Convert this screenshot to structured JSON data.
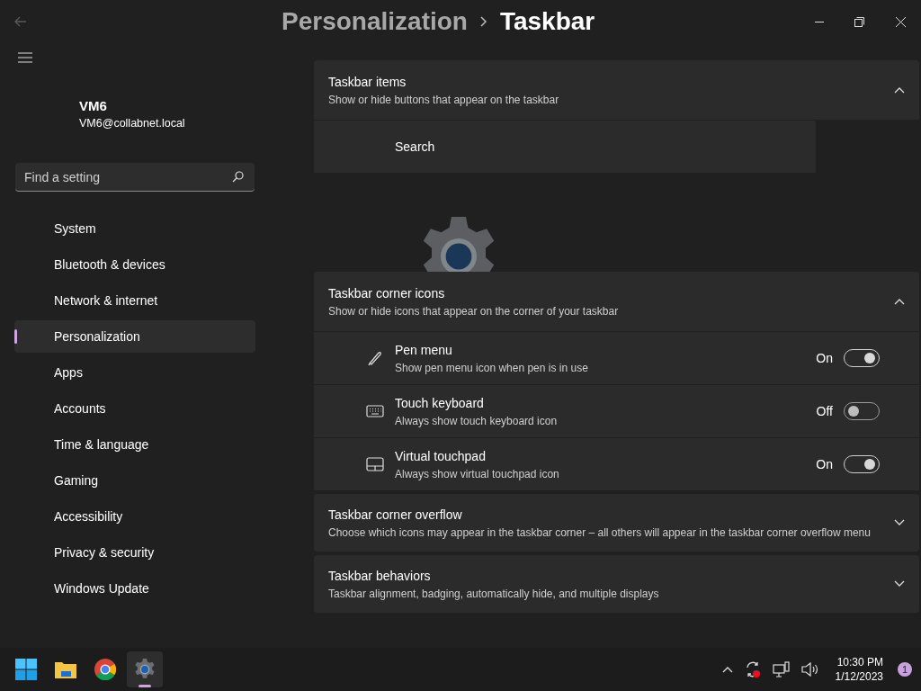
{
  "breadcrumb": {
    "parent": "Personalization",
    "current": "Taskbar"
  },
  "user": {
    "name": "VM6",
    "email": "VM6@collabnet.local"
  },
  "search": {
    "placeholder": "Find a setting"
  },
  "nav": [
    {
      "label": "System",
      "selected": false
    },
    {
      "label": "Bluetooth & devices",
      "selected": false
    },
    {
      "label": "Network & internet",
      "selected": false
    },
    {
      "label": "Personalization",
      "selected": true
    },
    {
      "label": "Apps",
      "selected": false
    },
    {
      "label": "Accounts",
      "selected": false
    },
    {
      "label": "Time & language",
      "selected": false
    },
    {
      "label": "Gaming",
      "selected": false
    },
    {
      "label": "Accessibility",
      "selected": false
    },
    {
      "label": "Privacy & security",
      "selected": false
    },
    {
      "label": "Windows Update",
      "selected": false
    }
  ],
  "taskbar_items": {
    "title": "Taskbar items",
    "subtitle": "Show or hide buttons that appear on the taskbar",
    "expanded": true,
    "rows": [
      {
        "label": "Search"
      }
    ]
  },
  "corner_icons": {
    "title": "Taskbar corner icons",
    "subtitle": "Show or hide icons that appear on the corner of your taskbar",
    "expanded": true,
    "rows": [
      {
        "kind": "pen",
        "label": "Pen menu",
        "description": "Show pen menu icon when pen is in use",
        "state_text": "On",
        "on": true
      },
      {
        "kind": "keyboard",
        "label": "Touch keyboard",
        "description": "Always show touch keyboard icon",
        "state_text": "Off",
        "on": false
      },
      {
        "kind": "touchpad",
        "label": "Virtual touchpad",
        "description": "Always show virtual touchpad icon",
        "state_text": "On",
        "on": true
      }
    ]
  },
  "collapsed_sections": [
    {
      "title": "Taskbar corner overflow",
      "subtitle": "Choose which icons may appear in the taskbar corner – all others will appear in the taskbar corner overflow menu",
      "expanded": false
    },
    {
      "title": "Taskbar behaviors",
      "subtitle": "Taskbar alignment, badging, automatically hide, and multiple displays",
      "expanded": false
    }
  ],
  "taskbar": {
    "apps": [
      {
        "kind": "start",
        "active": false
      },
      {
        "kind": "folder",
        "active": false
      },
      {
        "kind": "browser",
        "active": false
      },
      {
        "kind": "settings",
        "active": true
      }
    ],
    "time": "10:30 PM",
    "date": "1/12/2023",
    "notification_count": "1"
  }
}
